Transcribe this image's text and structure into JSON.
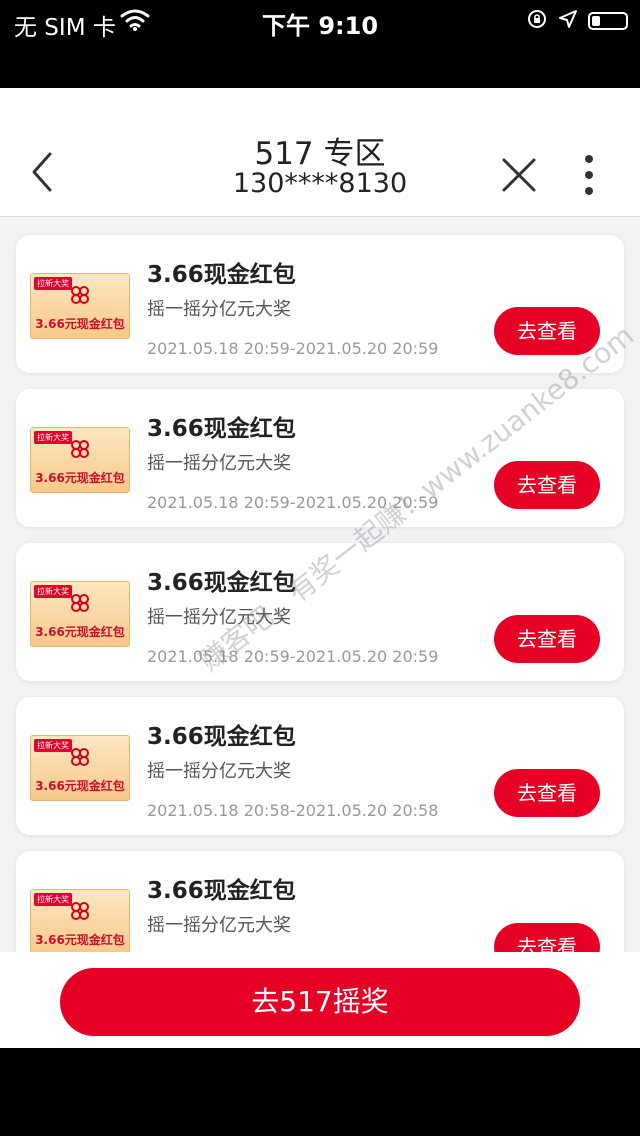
{
  "status_bar": {
    "carrier": "无 SIM 卡",
    "time": "下午 9:10",
    "icons": [
      "wifi-icon",
      "orientation-lock-icon",
      "location-icon",
      "battery-icon"
    ]
  },
  "header": {
    "title": "517 专区",
    "phone": "130****8130",
    "icons": [
      "back-chevron-icon",
      "close-icon",
      "more-vertical-icon"
    ]
  },
  "cards": [
    {
      "title": "3.66现金红包",
      "desc": "摇一摇分亿元大奖",
      "time": "2021.05.18 20:59-2021.05.20 20:59",
      "button": "去查看",
      "thumb_tag": "拉新大奖",
      "thumb_text": "3.66元现金红包"
    },
    {
      "title": "3.66现金红包",
      "desc": "摇一摇分亿元大奖",
      "time": "2021.05.18 20:59-2021.05.20 20:59",
      "button": "去查看",
      "thumb_tag": "拉新大奖",
      "thumb_text": "3.66元现金红包"
    },
    {
      "title": "3.66现金红包",
      "desc": "摇一摇分亿元大奖",
      "time": "2021.05.18 20:59-2021.05.20 20:59",
      "button": "去查看",
      "thumb_tag": "拉新大奖",
      "thumb_text": "3.66元现金红包"
    },
    {
      "title": "3.66现金红包",
      "desc": "摇一摇分亿元大奖",
      "time": "2021.05.18 20:58-2021.05.20 20:58",
      "button": "去查看",
      "thumb_tag": "拉新大奖",
      "thumb_text": "3.66元现金红包"
    },
    {
      "title": "3.66现金红包",
      "desc": "摇一摇分亿元大奖",
      "time": "",
      "button": "去查看",
      "thumb_tag": "拉新大奖",
      "thumb_text": "3.66元现金红包"
    }
  ],
  "footer": {
    "button": "去517摇奖"
  },
  "watermark": "赚客吧，有奖一起赚！www.zuanke8.com",
  "colors": {
    "accent": "#e60024",
    "background": "#f3f3f5",
    "card": "#ffffff"
  }
}
